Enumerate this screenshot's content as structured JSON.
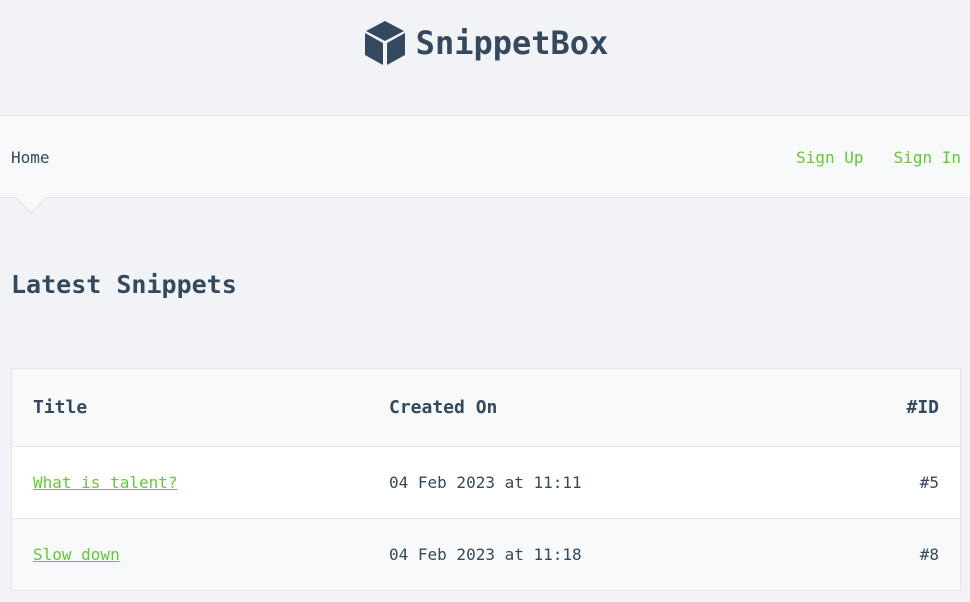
{
  "header": {
    "brand_name": "SnippetBox",
    "logo_icon": "cube-icon",
    "logo_color": "#34495e"
  },
  "nav": {
    "home_label": "Home",
    "sign_up_label": "Sign Up",
    "sign_in_label": "Sign In",
    "link_color": "#62cb31"
  },
  "main": {
    "title": "Latest Snippets",
    "table": {
      "columns": [
        "Title",
        "Created On",
        "#ID"
      ],
      "rows": [
        {
          "title": "What is talent?",
          "created_on": "04 Feb 2023 at 11:11",
          "id": "#5"
        },
        {
          "title": "Slow down",
          "created_on": "04 Feb 2023 at 11:18",
          "id": "#8"
        }
      ]
    }
  }
}
